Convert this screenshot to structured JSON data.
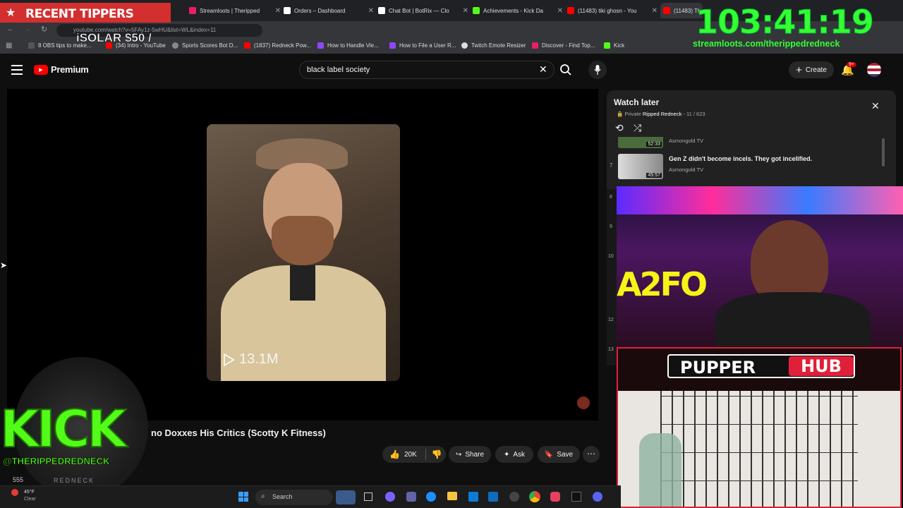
{
  "tabs": [
    {
      "label": "Streamloots | Theripped",
      "color": "#e91e63"
    },
    {
      "label": "Orders – Dashboard",
      "color": "#ffffff"
    },
    {
      "label": "Chat Bot | BotRix — Clo",
      "color": "#ffffff"
    },
    {
      "label": "Achievements - Kick Da",
      "color": "#53fc18"
    },
    {
      "label": "(11483) tiki ghosn - You",
      "color": "#ff0000"
    },
    {
      "label": "(11483) Th",
      "color": "#ff0000"
    }
  ],
  "url": "youtube.com/watch?v=5FAy1z-5wHU&list=WL&index=11",
  "bookmarks": [
    "8 OBS tips to make...",
    "(34) Intro - YouTube",
    "Sports Scores Bot D...",
    "(1837) Redneck Pow...",
    "How to Handle Vie...",
    "How to File a User R...",
    "Twitch Emote Resizer",
    "Discover - Find Top...",
    "Kick"
  ],
  "overlay": {
    "recent_tippers": "RECENT TIPPERS",
    "tipper": "iSOLAR $50 /",
    "timer": "103:41:19",
    "streamloots": "streamloots.com/therippedredneck",
    "kick_logo": "KICK",
    "kick_handle": "@THERIPPEDREDNECK",
    "kick_sub": "REDNECK",
    "pupper": "PUPPER",
    "hub": "HUB",
    "cam_text": "A2FO"
  },
  "youtube": {
    "logo": "Premium",
    "search_value": "black label society",
    "create": "Create",
    "notif_badge": "9+",
    "video_title": "no Doxxes His Critics (Scotty K Fitness)",
    "views": "13.1M",
    "likes": "20K",
    "share": "Share",
    "ask": "Ask",
    "save": "Save",
    "subs_partial": "555"
  },
  "playlist": {
    "title": "Watch later",
    "private": "Private",
    "owner": "Ripped Redneck",
    "position": "11 / 623",
    "items": [
      {
        "num": "",
        "title": "",
        "channel": "Asmongold TV",
        "duration": "52:33"
      },
      {
        "num": "7",
        "title": "Gen Z didn't become incels. They got incelified.",
        "channel": "Asmongold TV",
        "duration": "45:57"
      }
    ],
    "side_numbers": [
      "8",
      "9",
      "10",
      "",
      "12",
      "13"
    ]
  },
  "taskbar": {
    "temp": "45°F",
    "weather": "Clear",
    "search": "Search"
  }
}
